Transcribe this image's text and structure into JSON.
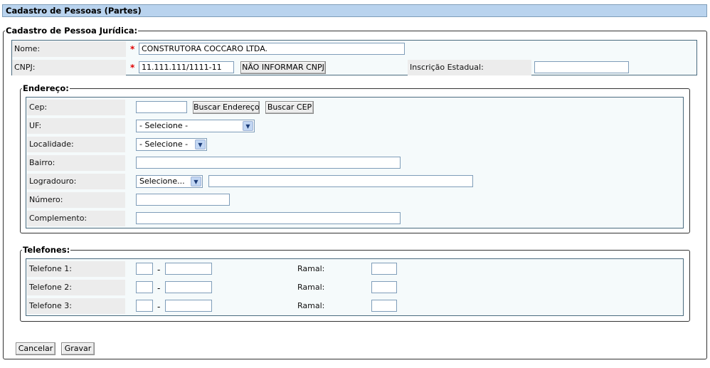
{
  "page": {
    "title": "Cadastro de Pessoas (Partes)"
  },
  "form": {
    "legend": "Cadastro de Pessoa Jurídica:",
    "nome": {
      "label": "Nome:",
      "value": "CONSTRUTORA COCCARO LTDA.",
      "required": "*"
    },
    "cnpj": {
      "label": "CNPJ:",
      "value": "11.111.111/1111-11",
      "required": "*",
      "nao_informar": "NÃO INFORMAR CNPJ"
    },
    "inscricao": {
      "label": "Inscrição Estadual:",
      "value": ""
    }
  },
  "endereco": {
    "legend": "Endereço:",
    "cep": {
      "label": "Cep:",
      "value": "",
      "buscar_endereco": "Buscar Endereço",
      "buscar_cep": "Buscar CEP"
    },
    "uf": {
      "label": "UF:",
      "selected": "- Selecione -"
    },
    "localidade": {
      "label": "Localidade:",
      "selected": "- Selecione -"
    },
    "bairro": {
      "label": "Bairro:",
      "value": ""
    },
    "logradouro": {
      "label": "Logradouro:",
      "selected": "Selecione...",
      "value": ""
    },
    "numero": {
      "label": "Número:",
      "value": ""
    },
    "complemento": {
      "label": "Complemento:",
      "value": ""
    }
  },
  "telefones": {
    "legend": "Telefones:",
    "rows": [
      {
        "label": "Telefone 1:",
        "ramal_label": "Ramal:",
        "separator": "-"
      },
      {
        "label": "Telefone 2:",
        "ramal_label": "Ramal:",
        "separator": "-"
      },
      {
        "label": "Telefone 3:",
        "ramal_label": "Ramal:",
        "separator": "-"
      }
    ]
  },
  "actions": {
    "cancelar": "Cancelar",
    "gravar": "Gravar"
  },
  "icons": {
    "dropdown": "chevron-down-icon"
  }
}
